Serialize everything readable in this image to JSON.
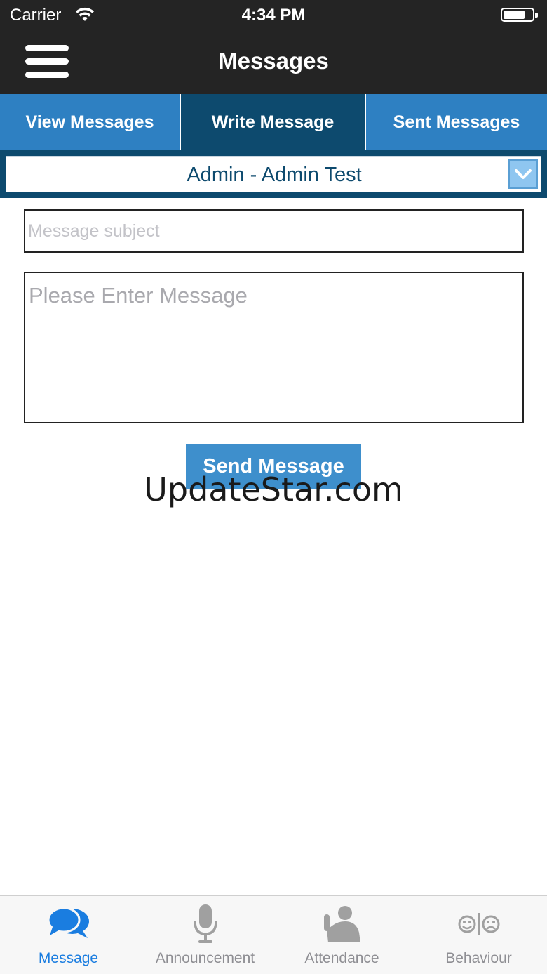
{
  "status_bar": {
    "carrier": "Carrier",
    "time": "4:34 PM"
  },
  "nav": {
    "title": "Messages",
    "menu_icon": "hamburger-menu-icon"
  },
  "tabs": [
    {
      "label": "View Messages",
      "active": false
    },
    {
      "label": "Write Message",
      "active": true
    },
    {
      "label": "Sent Messages",
      "active": false
    }
  ],
  "recipient": {
    "selected": "Admin - Admin Test",
    "icon": "chevron-down-icon"
  },
  "form": {
    "subject_placeholder": "Message subject",
    "subject_value": "",
    "message_placeholder": "Please Enter Message",
    "message_value": "",
    "send_label": "Send Message"
  },
  "watermark": "UpdateStar.com",
  "bottom_tabs": [
    {
      "label": "Message",
      "icon": "chat-bubbles-icon",
      "active": true
    },
    {
      "label": "Announcement",
      "icon": "microphone-icon",
      "active": false
    },
    {
      "label": "Attendance",
      "icon": "person-raising-hand-icon",
      "active": false
    },
    {
      "label": "Behaviour",
      "icon": "smiley-frowny-icon",
      "active": false
    }
  ],
  "colors": {
    "dark_bar": "#242424",
    "tab_blue": "#2e80c2",
    "tab_active": "#0d4a6e",
    "button_blue": "#3e8fcc",
    "tabbar_active": "#1a7de0",
    "tabbar_inactive": "#8e8e93"
  }
}
